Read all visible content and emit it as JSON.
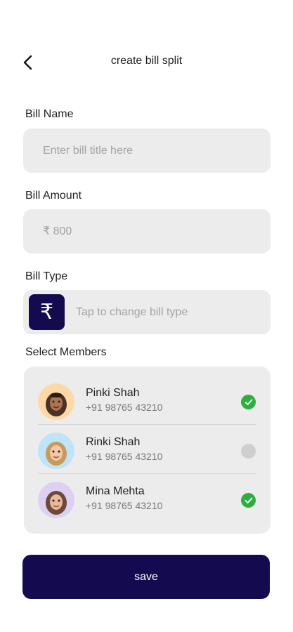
{
  "header": {
    "title": "create bill split",
    "back_icon": "chevron-left-icon"
  },
  "bill_name": {
    "label": "Bill Name",
    "placeholder": "Enter bill title here",
    "value": ""
  },
  "bill_amount": {
    "label": "Bill Amount",
    "placeholder": "₹ 800",
    "value": ""
  },
  "bill_type": {
    "label": "Bill Type",
    "icon": "rupee-icon",
    "icon_glyph": "₹",
    "placeholder": "Tap to change bill type"
  },
  "members": {
    "label": "Select Members",
    "items": [
      {
        "name": "Pinki Shah",
        "phone": "+91 98765 43210",
        "selected": true,
        "avatar_color": "#ffd8a8"
      },
      {
        "name": "Rinki Shah",
        "phone": "+91 98765 43210",
        "selected": false,
        "avatar_color": "#bfe4f7"
      },
      {
        "name": "Mina Mehta",
        "phone": "+91 98765 43210",
        "selected": true,
        "avatar_color": "#ddd0f3"
      }
    ]
  },
  "actions": {
    "save_label": "save"
  },
  "colors": {
    "primary": "#140a4f",
    "field_bg": "#ececec",
    "check_on": "#2fae3f",
    "check_off": "#cfcfcf"
  }
}
